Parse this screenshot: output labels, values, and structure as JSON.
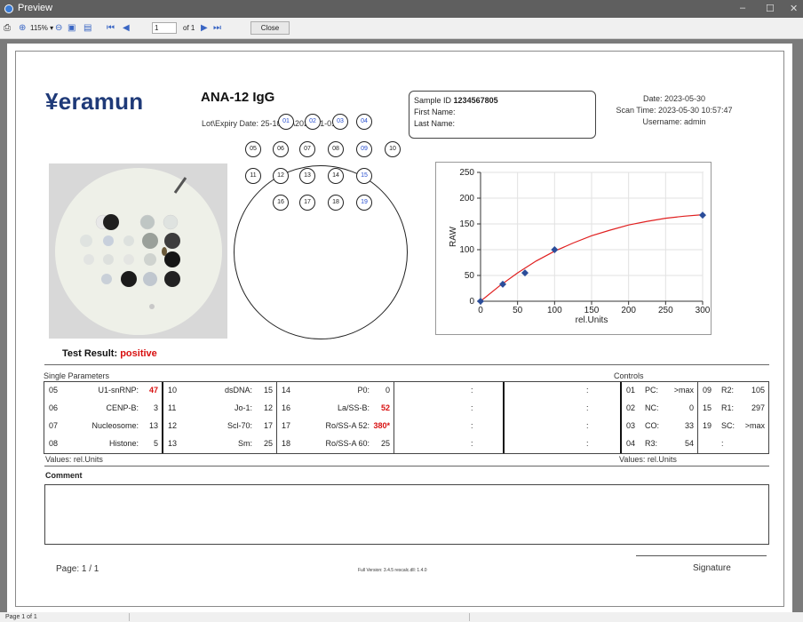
{
  "window": {
    "title": "Preview",
    "controls": [
      "–",
      "☐",
      "✕"
    ]
  },
  "toolbar": {
    "zoom": "115% ▾",
    "page_input": "1",
    "page_of": "of 1",
    "close_label": "Close"
  },
  "statusbar": {
    "text": "Page 1 of 1"
  },
  "report": {
    "logo": "¥eramun",
    "test_name": "ANA-12 IgG",
    "lot_expiry": "Lot\\Expiry Date: 25-10-22\\2024-01-01",
    "sample_id_label": "Sample ID",
    "sample_id": "1234567805",
    "first_name": "First Name:",
    "last_name": "Last Name:",
    "date": "Date: 2023-05-30",
    "scan_time": "Scan Time: 2023-05-30 10:57:47",
    "username": "Username: admin",
    "result_label": "Test Result:",
    "result_value": "positive",
    "single_params_header": "Single Parameters",
    "controls_header": "Controls",
    "values_left": "Values: rel.Units",
    "values_right": "Values: rel.Units",
    "comment_header": "Comment",
    "comment": "",
    "page": "Page: 1 / 1",
    "version": "Full Version: 3.4.5 rescalc.dll: 1.4.0",
    "signature": "Signature"
  },
  "wells": [
    {
      "id": "01",
      "blue": true
    },
    {
      "id": "02",
      "blue": true
    },
    {
      "id": "03",
      "blue": true
    },
    {
      "id": "04",
      "blue": true
    },
    {
      "id": "05",
      "blue": false
    },
    {
      "id": "06",
      "blue": false
    },
    {
      "id": "07",
      "blue": false
    },
    {
      "id": "08",
      "blue": false
    },
    {
      "id": "09",
      "blue": true
    },
    {
      "id": "10",
      "blue": false
    },
    {
      "id": "11",
      "blue": false
    },
    {
      "id": "12",
      "blue": false
    },
    {
      "id": "13",
      "blue": false
    },
    {
      "id": "14",
      "blue": false
    },
    {
      "id": "15",
      "blue": true
    },
    {
      "id": "16",
      "blue": false
    },
    {
      "id": "17",
      "blue": false
    },
    {
      "id": "18",
      "blue": false
    },
    {
      "id": "19",
      "blue": true
    }
  ],
  "params": {
    "col1": [
      {
        "no": "05",
        "name": "U1-snRNP:",
        "val": "47",
        "red": true
      },
      {
        "no": "06",
        "name": "CENP-B:",
        "val": "3",
        "red": false
      },
      {
        "no": "07",
        "name": "Nucleosome:",
        "val": "13",
        "red": false
      },
      {
        "no": "08",
        "name": "Histone:",
        "val": "5",
        "red": false
      }
    ],
    "col2": [
      {
        "no": "10",
        "name": "dsDNA:",
        "val": "15",
        "red": false
      },
      {
        "no": "11",
        "name": "Jo-1:",
        "val": "12",
        "red": false
      },
      {
        "no": "12",
        "name": "Scl-70:",
        "val": "17",
        "red": false
      },
      {
        "no": "13",
        "name": "Sm:",
        "val": "25",
        "red": false
      }
    ],
    "col3": [
      {
        "no": "14",
        "name": "P0:",
        "val": "0",
        "red": false
      },
      {
        "no": "16",
        "name": "La/SS-B:",
        "val": "52",
        "red": true
      },
      {
        "no": "17",
        "name": "Ro/SS-A 52:",
        "val": "380*",
        "red": true
      },
      {
        "no": "18",
        "name": "Ro/SS-A 60:",
        "val": "25",
        "red": false
      }
    ],
    "empty_colon": ":",
    "ctl1": [
      {
        "no": "01",
        "name": "PC:",
        "val": ">max"
      },
      {
        "no": "02",
        "name": "NC:",
        "val": "0"
      },
      {
        "no": "03",
        "name": "CO:",
        "val": "33"
      },
      {
        "no": "04",
        "name": "R3:",
        "val": "54"
      }
    ],
    "ctl2": [
      {
        "no": "09",
        "name": "R2:",
        "val": "105"
      },
      {
        "no": "15",
        "name": "R1:",
        "val": "297"
      },
      {
        "no": "19",
        "name": "SC:",
        "val": ">max"
      },
      {
        "no": "",
        "name": ":",
        "val": ""
      }
    ]
  },
  "chart_data": {
    "type": "scatter",
    "xlabel": "rel.Units",
    "ylabel": "RAW",
    "xlim": [
      0,
      300
    ],
    "ylim": [
      0,
      250
    ],
    "xticks": [
      0,
      50,
      100,
      150,
      200,
      250,
      300
    ],
    "yticks": [
      0,
      50,
      100,
      150,
      200,
      250
    ],
    "points": [
      {
        "x": 0,
        "y": 0
      },
      {
        "x": 30,
        "y": 33
      },
      {
        "x": 60,
        "y": 55
      },
      {
        "x": 100,
        "y": 100
      },
      {
        "x": 300,
        "y": 167
      }
    ],
    "fit_curve": [
      {
        "x": 0,
        "y": 0
      },
      {
        "x": 25,
        "y": 29
      },
      {
        "x": 50,
        "y": 55
      },
      {
        "x": 75,
        "y": 78
      },
      {
        "x": 100,
        "y": 97
      },
      {
        "x": 125,
        "y": 113
      },
      {
        "x": 150,
        "y": 127
      },
      {
        "x": 175,
        "y": 138
      },
      {
        "x": 200,
        "y": 148
      },
      {
        "x": 225,
        "y": 155
      },
      {
        "x": 250,
        "y": 161
      },
      {
        "x": 275,
        "y": 165
      },
      {
        "x": 300,
        "y": 168
      }
    ],
    "point_color": "#2b4d9a",
    "curve_color": "#e02020"
  }
}
